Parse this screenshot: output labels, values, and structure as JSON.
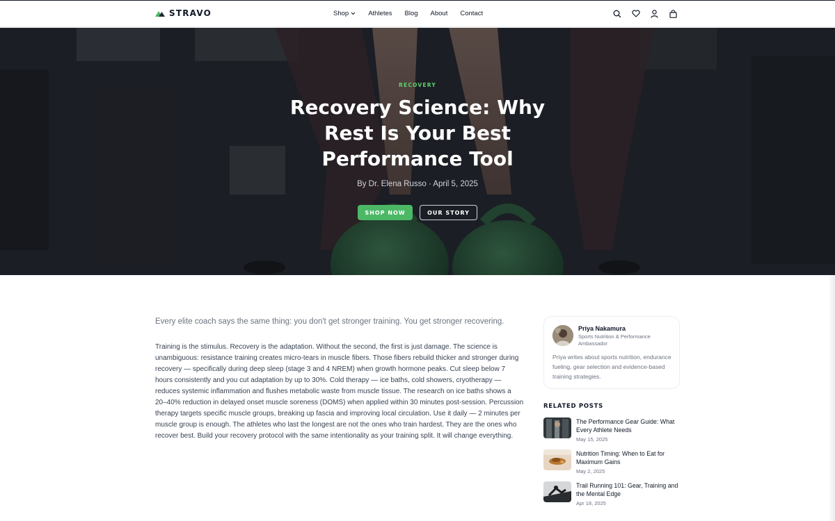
{
  "brand": {
    "name": "STRAVO",
    "accent_color": "#4cb866"
  },
  "nav": {
    "items": [
      {
        "label": "Shop",
        "has_dropdown": true
      },
      {
        "label": "Athletes"
      },
      {
        "label": "Blog"
      },
      {
        "label": "About"
      },
      {
        "label": "Contact"
      }
    ]
  },
  "header_icons": [
    "search-icon",
    "heart-icon",
    "user-icon",
    "bag-icon"
  ],
  "hero": {
    "category": "RECOVERY",
    "title": "Recovery Science: Why Rest Is Your Best Performance Tool",
    "byline": "By Dr. Elena Russo · April 5, 2025",
    "primary_button": "SHOP NOW",
    "secondary_button": "OUR STORY"
  },
  "article": {
    "lead": "Every elite coach says the same thing: you don't get stronger training. You get stronger recovering.",
    "body": "Training is the stimulus. Recovery is the adaptation. Without the second, the first is just damage. The science is unambiguous: resistance training creates micro-tears in muscle fibers. Those fibers rebuild thicker and stronger during recovery — specifically during deep sleep (stage 3 and 4 NREM) when growth hormone peaks. Cut sleep below 7 hours consistently and you cut adaptation by up to 30%. Cold therapy — ice baths, cold showers, cryotherapy — reduces systemic inflammation and flushes metabolic waste from muscle tissue. The research on ice baths shows a 20–40% reduction in delayed onset muscle soreness (DOMS) when applied within 30 minutes post-session. Percussion therapy targets specific muscle groups, breaking up fascia and improving local circulation. Use it daily — 2 minutes per muscle group is enough. The athletes who last the longest are not the ones who train hardest. They are the ones who recover best. Build your recovery protocol with the same intentionality as your training split. It will change everything."
  },
  "author": {
    "name": "Priya Nakamura",
    "role": "Sports Nutrition & Performance Ambassador",
    "bio": "Priya writes about sports nutrition, endurance fueling, gear selection and evidence-based training strategies."
  },
  "related": {
    "heading": "RELATED POSTS",
    "posts": [
      {
        "title": "The Performance Gear Guide: What Every Athlete Needs",
        "date": "May 15, 2025"
      },
      {
        "title": "Nutrition Timing: When to Eat for Maximum Gains",
        "date": "May 2, 2025"
      },
      {
        "title": "Trail Running 101: Gear, Training and the Mental Edge",
        "date": "Apr 18, 2025"
      }
    ]
  }
}
